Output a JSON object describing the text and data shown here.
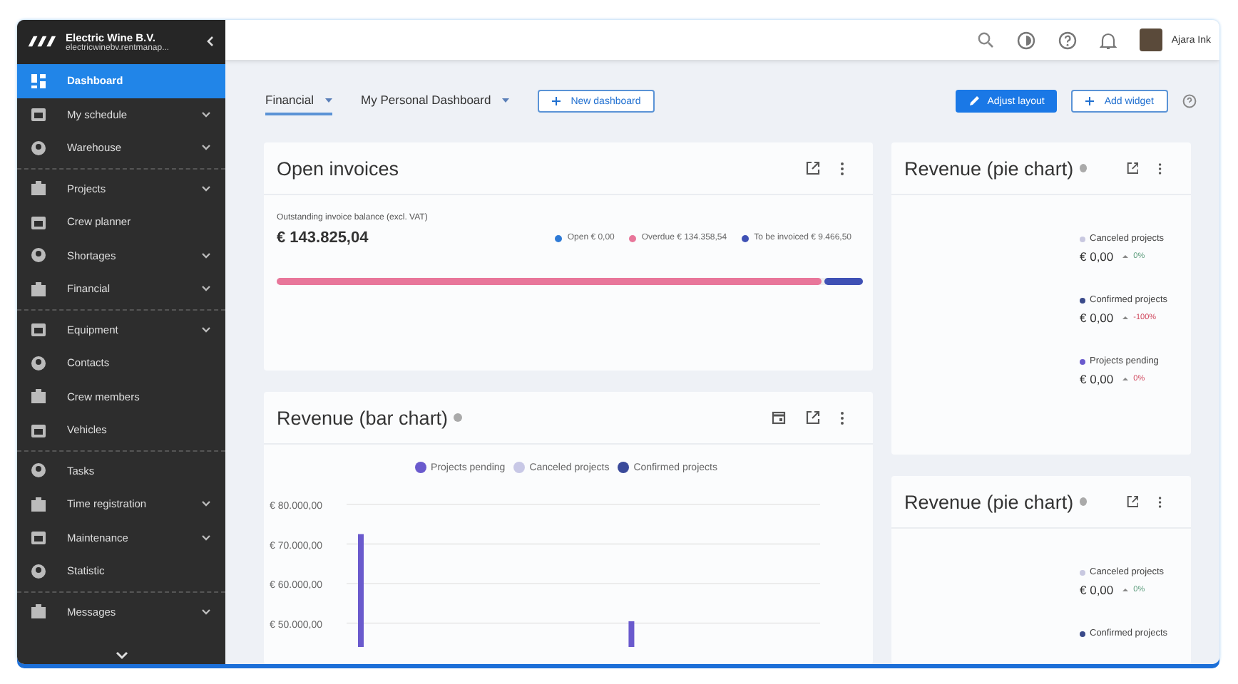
{
  "company": {
    "name": "Electric Wine B.V.",
    "domain": "electricwinebv.rentmanap..."
  },
  "sidebar": {
    "groups": [
      {
        "items": [
          {
            "label": "Dashboard",
            "selected": true,
            "expandable": false
          },
          {
            "label": "My schedule",
            "selected": false,
            "expandable": true
          },
          {
            "label": "Warehouse",
            "selected": false,
            "expandable": true
          }
        ]
      },
      {
        "items": [
          {
            "label": "Projects",
            "selected": false,
            "expandable": true
          },
          {
            "label": "Crew planner",
            "selected": false,
            "expandable": false
          },
          {
            "label": "Shortages",
            "selected": false,
            "expandable": true
          },
          {
            "label": "Financial",
            "selected": false,
            "expandable": true
          }
        ]
      },
      {
        "items": [
          {
            "label": "Equipment",
            "selected": false,
            "expandable": true
          },
          {
            "label": "Contacts",
            "selected": false,
            "expandable": false
          },
          {
            "label": "Crew members",
            "selected": false,
            "expandable": false
          },
          {
            "label": "Vehicles",
            "selected": false,
            "expandable": false
          }
        ]
      },
      {
        "items": [
          {
            "label": "Tasks",
            "selected": false,
            "expandable": false
          },
          {
            "label": "Time registration",
            "selected": false,
            "expandable": true
          },
          {
            "label": "Maintenance",
            "selected": false,
            "expandable": true
          },
          {
            "label": "Statistic",
            "selected": false,
            "expandable": false
          }
        ]
      },
      {
        "items": [
          {
            "label": "Messages",
            "selected": false,
            "expandable": true
          }
        ]
      }
    ]
  },
  "user": {
    "name": "Ajara Ink"
  },
  "dashboard_tabs": [
    {
      "label": "Financial",
      "selected": true
    },
    {
      "label": "My Personal Dashboard",
      "selected": false
    }
  ],
  "new_dashboard": "New dashboard",
  "adjust_layout": "Adjust layout",
  "add_widget": "Add widget",
  "open_invoices": {
    "title": "Open invoices",
    "caption": "Outstanding invoice balance (excl. VAT)",
    "total": "€ 143.825,04",
    "segments": [
      {
        "label": "Open € 0,00",
        "color": "#2e7ad6"
      },
      {
        "label": "Overdue € 134.358,54",
        "color": "#e8769a",
        "level": 0.934
      },
      {
        "label": "To be invoiced € 9.466,50",
        "color": "#3f51b5",
        "level": 0.066
      }
    ]
  },
  "bar_chart": {
    "title": "Revenue (bar chart)",
    "chart_data": {
      "type": "bar",
      "grid": true,
      "ylim": [
        44000,
        80000
      ],
      "yticks": [
        {
          "value": 50000,
          "label": "€ 50.000,00"
        },
        {
          "value": 60000,
          "label": "€ 60.000,00"
        },
        {
          "value": 70000,
          "label": "€ 70.000,00"
        },
        {
          "value": 80000,
          "label": "€ 80.000,00"
        }
      ],
      "series": [
        {
          "name": "Projects pending",
          "color": "#6a5acd",
          "values": [
            72500,
            null,
            null,
            null,
            null,
            null,
            null,
            null,
            50500,
            null,
            null,
            null,
            null,
            null
          ]
        },
        {
          "name": "Canceled projects",
          "color": "#c8c8e6",
          "values": [
            null,
            null,
            null,
            null,
            null,
            null,
            null,
            null,
            null,
            null,
            null,
            null,
            null,
            null
          ]
        },
        {
          "name": "Confirmed projects",
          "color": "#3a4a9a",
          "values": [
            null,
            null,
            null,
            null,
            null,
            null,
            null,
            null,
            null,
            null,
            null,
            null,
            null,
            null
          ]
        }
      ]
    }
  },
  "pie_cards": [
    {
      "title": "Revenue (pie chart)",
      "legend": [
        {
          "label": "Canceled projects",
          "color": "#c8c8e0",
          "value": "€ 0,00",
          "change": "0%",
          "negative": false
        },
        {
          "label": "Confirmed projects",
          "color": "#3a4a8a",
          "value": "€ 0,00",
          "change": "-100%",
          "negative": true
        },
        {
          "label": "Projects pending",
          "color": "#6a5acd",
          "value": "€ 0,00",
          "change": "0%",
          "negative": true
        }
      ]
    },
    {
      "title": "Revenue (pie chart)",
      "legend": [
        {
          "label": "Canceled projects",
          "color": "#c8c8e0",
          "value": "€ 0,00",
          "change": "0%",
          "negative": false
        },
        {
          "label": "Confirmed projects",
          "color": "#3a4a8a"
        }
      ]
    }
  ]
}
